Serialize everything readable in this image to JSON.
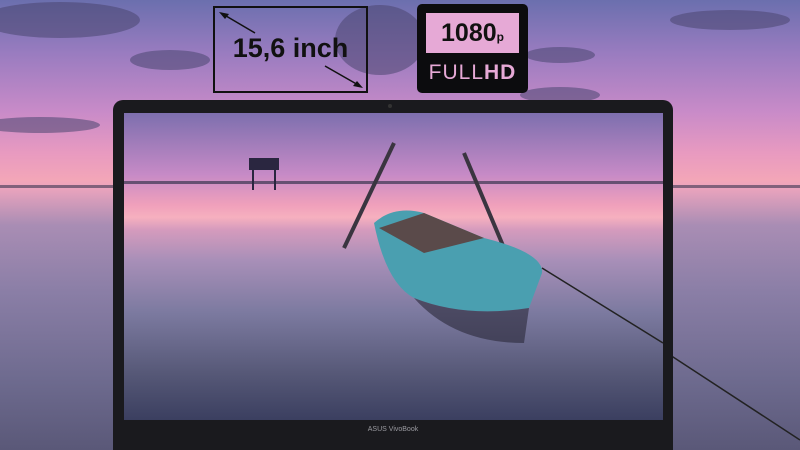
{
  "badges": {
    "screen_size": "15,6 inch",
    "resolution": "1080",
    "resolution_suffix": "p",
    "full_label": "FULL",
    "hd_label": "HD"
  },
  "laptop": {
    "brand_label": "ASUS VivoBook"
  },
  "colors": {
    "badge_pink": "#e6a9d6",
    "bezel": "#1a1a1e"
  }
}
